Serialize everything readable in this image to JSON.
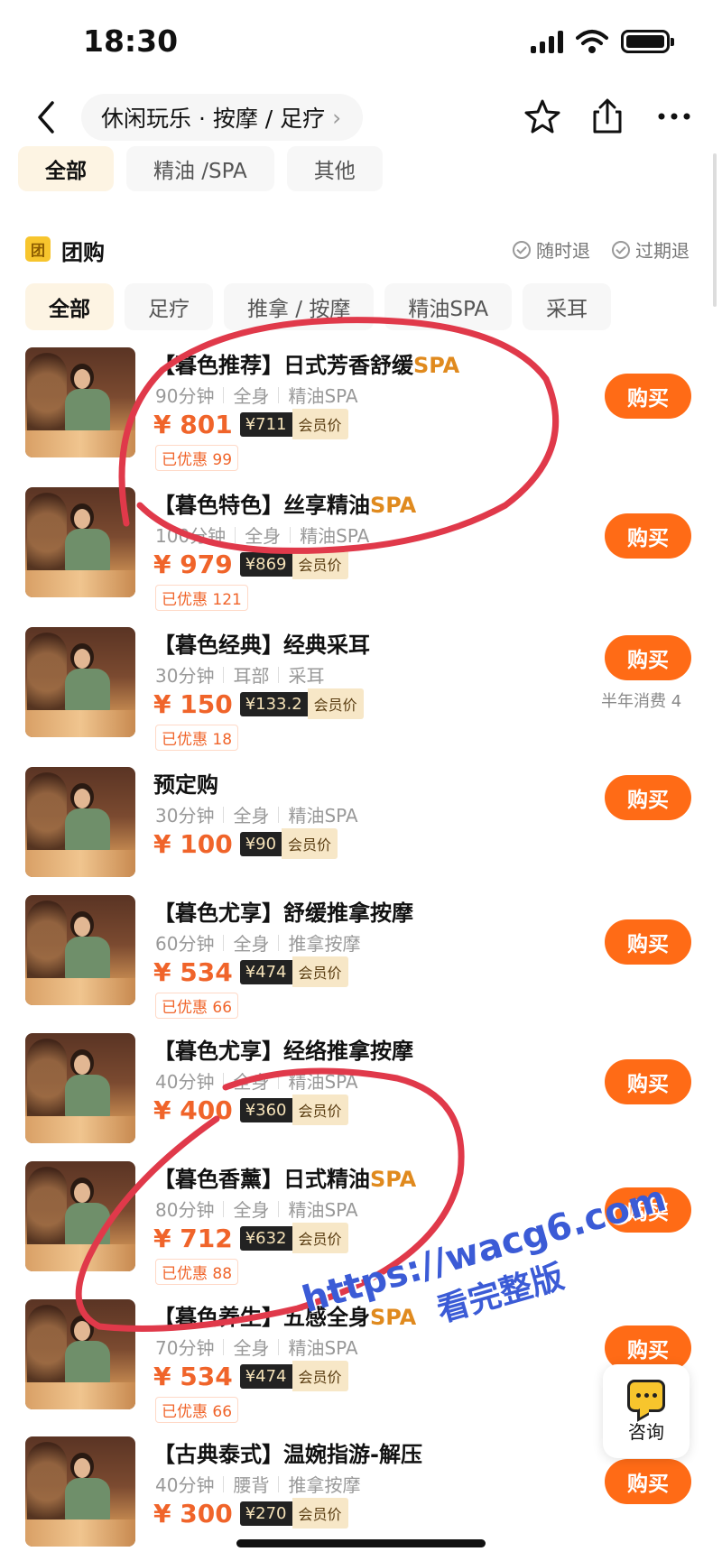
{
  "status_bar": {
    "time": "18:30"
  },
  "nav": {
    "breadcrumb": "休闲玩乐 · 按摩 / 足疗",
    "breadcrumb_arrow": "›",
    "icons": [
      "back-arrow-icon",
      "star-icon",
      "share-icon",
      "more-icon"
    ]
  },
  "category_tabs": [
    "全部",
    "精油 /SPA",
    "其他"
  ],
  "group": {
    "badge": "团",
    "title": "团购",
    "policy_1": "随时退",
    "policy_2": "过期退"
  },
  "sub_tabs": [
    "全部",
    "足疗",
    "推拿 / 按摩",
    "精油SPA",
    "采耳"
  ],
  "deals": [
    {
      "prefix": "【暮色推荐】日式芳香舒缓",
      "suffix": "SPA",
      "duration": "90分钟",
      "area": "全身",
      "kind": "精油SPA",
      "price": "¥ 801",
      "vip_price": "¥711",
      "vip_tag": "会员价",
      "discount": "已优惠 99",
      "buy": "购买",
      "note": ""
    },
    {
      "prefix": "【暮色特色】丝享精油",
      "suffix": "SPA",
      "duration": "100分钟",
      "area": "全身",
      "kind": "精油SPA",
      "price": "¥ 979",
      "vip_price": "¥869",
      "vip_tag": "会员价",
      "discount": "已优惠 121",
      "buy": "购买",
      "note": ""
    },
    {
      "prefix": "【暮色经典】经典采耳",
      "suffix": "",
      "duration": "30分钟",
      "area": "耳部",
      "kind": "采耳",
      "price": "¥ 150",
      "vip_price": "¥133.2",
      "vip_tag": "会员价",
      "discount": "已优惠 18",
      "buy": "购买",
      "note": "半年消费 4"
    },
    {
      "prefix": "预定购",
      "suffix": "",
      "duration": "30分钟",
      "area": "全身",
      "kind": "精油SPA",
      "price": "¥ 100",
      "vip_price": "¥90",
      "vip_tag": "会员价",
      "discount": "",
      "buy": "购买",
      "note": ""
    },
    {
      "prefix": "【暮色尤享】舒缓推拿按摩",
      "suffix": "",
      "duration": "60分钟",
      "area": "全身",
      "kind": "推拿按摩",
      "price": "¥ 534",
      "vip_price": "¥474",
      "vip_tag": "会员价",
      "discount": "已优惠 66",
      "buy": "购买",
      "note": ""
    },
    {
      "prefix": "【暮色尤享】经络推拿按摩",
      "suffix": "",
      "duration": "40分钟",
      "area": "全身",
      "kind": "精油SPA",
      "price": "¥ 400",
      "vip_price": "¥360",
      "vip_tag": "会员价",
      "discount": "",
      "buy": "购买",
      "note": ""
    },
    {
      "prefix": "【暮色香薰】日式精油",
      "suffix": "SPA",
      "duration": "80分钟",
      "area": "全身",
      "kind": "精油SPA",
      "price": "¥ 712",
      "vip_price": "¥632",
      "vip_tag": "会员价",
      "discount": "已优惠 88",
      "buy": "购买",
      "note": ""
    },
    {
      "prefix": "【暮色养生】五感全身",
      "suffix": "SPA",
      "duration": "70分钟",
      "area": "全身",
      "kind": "精油SPA",
      "price": "¥ 534",
      "vip_price": "¥474",
      "vip_tag": "会员价",
      "discount": "已优惠 66",
      "buy": "购买",
      "note": ""
    },
    {
      "prefix": "【古典泰式】温婉指游-解压",
      "suffix": "",
      "duration": "40分钟",
      "area": "腰背",
      "kind": "推拿按摩",
      "price": "¥ 300",
      "vip_price": "¥270",
      "vip_tag": "会员价",
      "discount": "",
      "buy": "购买",
      "note": ""
    }
  ],
  "consult": {
    "label": "咨询"
  },
  "watermark": {
    "line1": "https://wacg6.com",
    "line2": "看完整版"
  },
  "colors": {
    "accent": "#ff6b16",
    "price": "#f0642a",
    "spa": "#e08a1e",
    "annotation": "#e0394a"
  }
}
